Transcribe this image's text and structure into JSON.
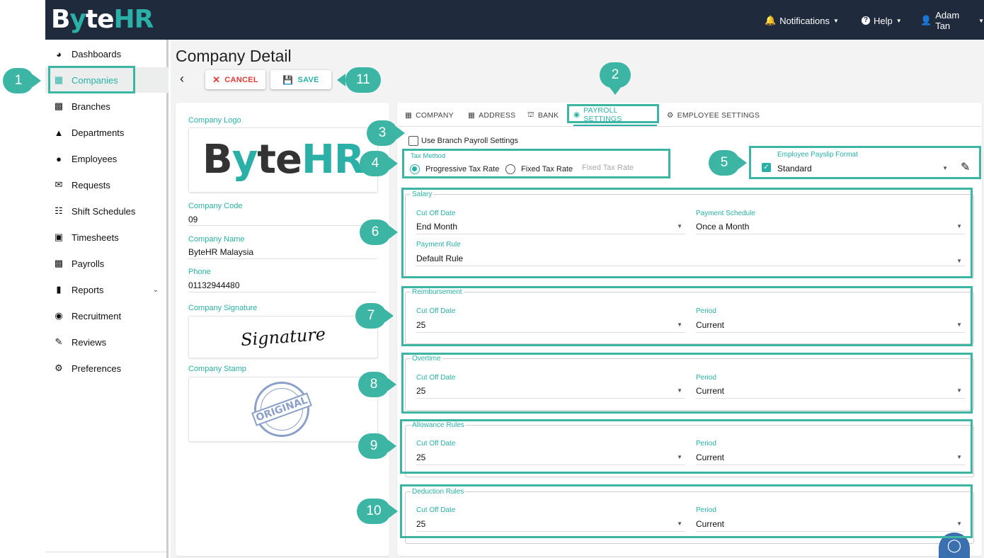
{
  "brand": {
    "logo_part1": "B",
    "logo_part2": "y",
    "logo_part3": "te",
    "logo_part4": "HR"
  },
  "topnav": {
    "notifications": "Notifications",
    "help": "Help",
    "user": "Adam Tan"
  },
  "sidebar": {
    "items": [
      {
        "label": "Dashboards",
        "icon": "dashboard-icon"
      },
      {
        "label": "Companies",
        "icon": "building-icon",
        "active": true
      },
      {
        "label": "Branches",
        "icon": "branch-icon"
      },
      {
        "label": "Departments",
        "icon": "sitemap-icon"
      },
      {
        "label": "Employees",
        "icon": "users-icon"
      },
      {
        "label": "Requests",
        "icon": "envelope-icon"
      },
      {
        "label": "Shift Schedules",
        "icon": "calendar-icon"
      },
      {
        "label": "Timesheets",
        "icon": "calendar-clock-icon"
      },
      {
        "label": "Payrolls",
        "icon": "money-icon"
      },
      {
        "label": "Reports",
        "icon": "report-icon",
        "expandable": true
      },
      {
        "label": "Recruitment",
        "icon": "user-search-icon"
      },
      {
        "label": "Reviews",
        "icon": "review-icon"
      },
      {
        "label": "Preferences",
        "icon": "cogs-icon"
      }
    ]
  },
  "page": {
    "title": "Company Detail",
    "cancel_label": "CANCEL",
    "save_label": "SAVE"
  },
  "company": {
    "logo_label": "Company Logo",
    "code_label": "Company Code",
    "code": "09",
    "name_label": "Company Name",
    "name": "ByteHR Malaysia",
    "phone_label": "Phone",
    "phone": "01132944480",
    "signature_label": "Company Signature",
    "signature_text": "Signature",
    "stamp_label": "Company Stamp",
    "stamp_text": "ORIGINAL"
  },
  "tabs": [
    {
      "label": "COMPANY",
      "icon": "building-icon"
    },
    {
      "label": "ADDRESS",
      "icon": "map-icon"
    },
    {
      "label": "BANK",
      "icon": "bank-icon"
    },
    {
      "label": "PAYROLL SETTINGS",
      "icon": "dollar-circle-icon",
      "active": true
    },
    {
      "label": "EMPLOYEE SETTINGS",
      "icon": "user-cog-icon"
    }
  ],
  "payroll": {
    "use_branch_label": "Use Branch Payroll Settings",
    "tax_method_label": "Tax Method",
    "tax_progressive": "Progressive Tax Rate",
    "tax_fixed": "Fixed Tax Rate",
    "fixed_rate_placeholder": "Fixed Tax Rate",
    "payslip_label": "Employee Payslip Format",
    "payslip_value": "Standard",
    "salary": {
      "legend": "Salary",
      "cutoff_label": "Cut Off Date",
      "cutoff": "End Month",
      "schedule_label": "Payment Schedule",
      "schedule": "Once a Month",
      "rule_label": "Payment Rule",
      "rule": "Default Rule"
    },
    "reimbursement": {
      "legend": "Reimbursement",
      "cutoff_label": "Cut Off Date",
      "cutoff": "25",
      "period_label": "Period",
      "period": "Current"
    },
    "overtime": {
      "legend": "Overtime",
      "cutoff_label": "Cut Off Date",
      "cutoff": "25",
      "period_label": "Period",
      "period": "Current"
    },
    "allowance": {
      "legend": "Allowance Rules",
      "cutoff_label": "Cut Off Date",
      "cutoff": "25",
      "period_label": "Period",
      "period": "Current"
    },
    "deduction": {
      "legend": "Deduction Rules",
      "cutoff_label": "Cut Off Date",
      "cutoff": "25",
      "period_label": "Period",
      "period": "Current"
    }
  },
  "callouts": [
    "1",
    "2",
    "3",
    "4",
    "5",
    "6",
    "7",
    "8",
    "9",
    "10",
    "11"
  ],
  "colors": {
    "accent": "#2ab0a6",
    "callout": "#3db5a4",
    "topbar": "#1f2a3c",
    "cancel": "#e53935"
  }
}
